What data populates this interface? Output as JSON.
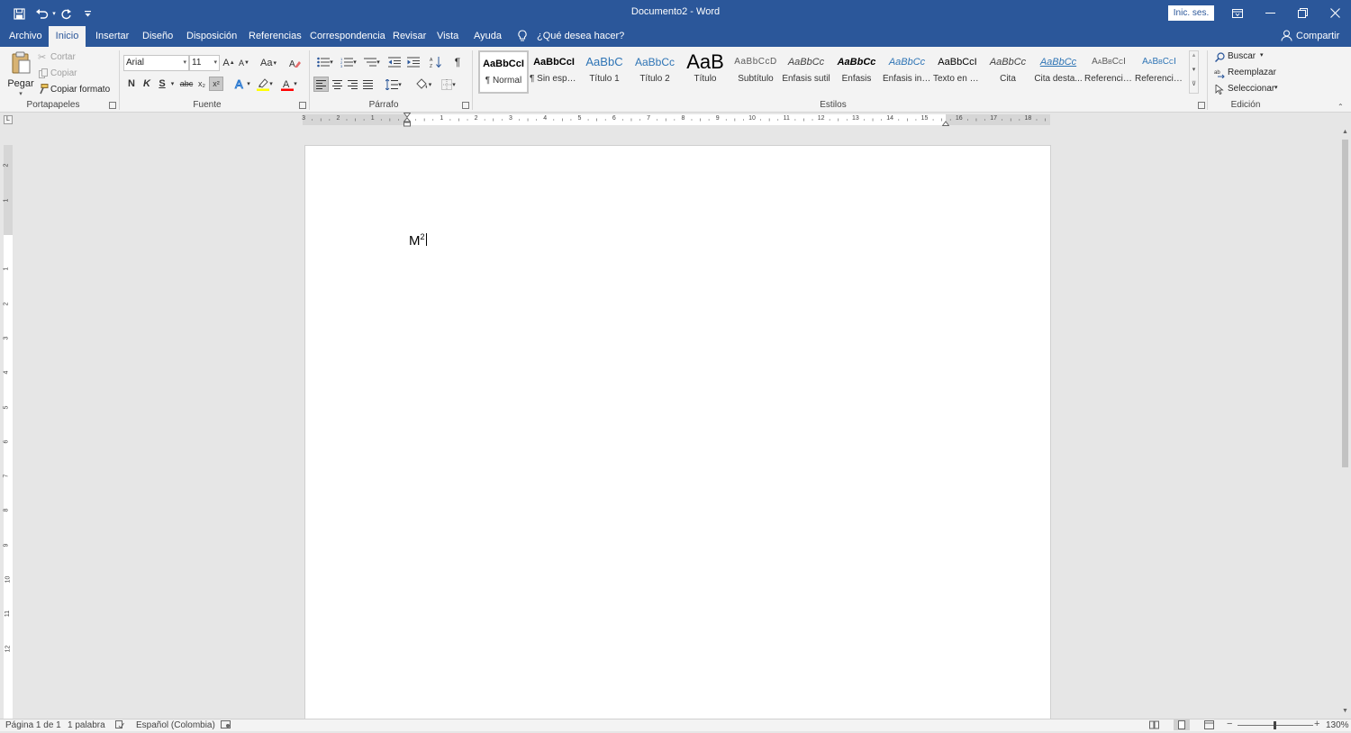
{
  "titlebar": {
    "title": "Documento2 - Word",
    "signin_label": "Inic. ses.",
    "qat": {
      "save_icon": "save-icon",
      "undo_icon": "undo-icon",
      "redo_icon": "redo-icon",
      "customize_icon": "customize-qat-icon"
    }
  },
  "tabs": [
    "Archivo",
    "Inicio",
    "Insertar",
    "Diseño",
    "Disposición",
    "Referencias",
    "Correspondencia",
    "Revisar",
    "Vista",
    "Ayuda"
  ],
  "tell_me": "¿Qué desea hacer?",
  "share_label": "Compartir",
  "clipboard": {
    "group": "Portapapeles",
    "paste": "Pegar",
    "cut": "Cortar",
    "copy": "Copiar",
    "format_painter": "Copiar formato"
  },
  "font": {
    "group": "Fuente",
    "name": "Arial",
    "size": "11",
    "grow": "A",
    "shrink": "A",
    "case": "Aa",
    "bold": "N",
    "italic": "K",
    "underline": "S",
    "strike": "abc",
    "subscript": "x₂",
    "superscript": "x²"
  },
  "paragraph": {
    "group": "Párrafo",
    "pilcrow": "¶"
  },
  "styles": {
    "group": "Estilos",
    "items": [
      {
        "preview": "AaBbCcI",
        "name": "¶ Normal"
      },
      {
        "preview": "AaBbCcI",
        "name": "¶ Sin espa..."
      },
      {
        "preview": "AaBbC",
        "name": "Título 1"
      },
      {
        "preview": "AaBbCc",
        "name": "Título 2"
      },
      {
        "preview": "AaB",
        "name": "Título"
      },
      {
        "preview": "AaBbCcD",
        "name": "Subtítulo"
      },
      {
        "preview": "AaBbCc",
        "name": "Énfasis sutil"
      },
      {
        "preview": "AaBbCc",
        "name": "Énfasis"
      },
      {
        "preview": "AaBbCc",
        "name": "Énfasis int..."
      },
      {
        "preview": "AaBbCcI",
        "name": "Texto en n..."
      },
      {
        "preview": "AaBbCc",
        "name": "Cita"
      },
      {
        "preview": "AaBbCc",
        "name": "Cita desta..."
      },
      {
        "preview": "AaBbCcI",
        "name": "Referencia..."
      },
      {
        "preview": "AaBbCcI",
        "name": "Referencia..."
      }
    ]
  },
  "editing": {
    "group": "Edición",
    "find": "Buscar",
    "replace": "Reemplazar",
    "select": "Seleccionar"
  },
  "ruler": {
    "left_numbers": [
      "3",
      "2",
      "1"
    ],
    "right_numbers": [
      "1",
      "2",
      "3",
      "4",
      "5",
      "6",
      "7",
      "8",
      "9",
      "10",
      "11",
      "12",
      "13",
      "14",
      "15",
      "16",
      "17",
      "18"
    ],
    "vertical_numbers": [
      "2",
      "1",
      "1",
      "2",
      "3",
      "4",
      "5",
      "6",
      "7",
      "8",
      "9",
      "10",
      "11",
      "12"
    ]
  },
  "document": {
    "base": "M",
    "superscript": "2"
  },
  "status": {
    "page": "Página 1 de 1",
    "words": "1 palabra",
    "language": "Español (Colombia)",
    "zoom": "130%"
  },
  "colors": {
    "accent": "#2b579a",
    "highlight": "#ffff00",
    "font_color": "#ff0000"
  }
}
